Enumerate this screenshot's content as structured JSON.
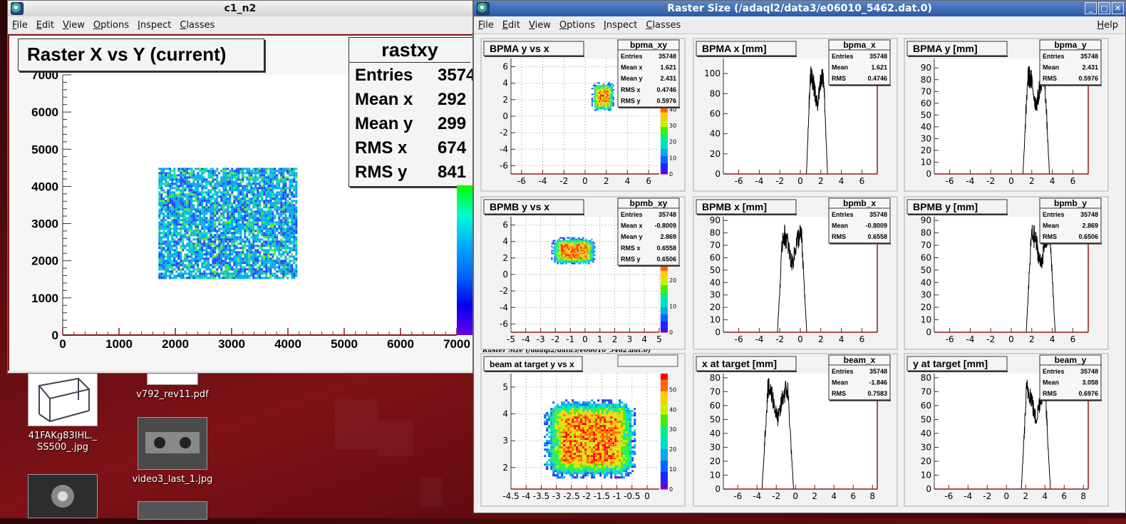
{
  "desktop": {
    "icons": [
      {
        "label": "41FAKg83IHL._\nSS500_.jpg"
      },
      {
        "label": "v792_rev11.pdf"
      },
      {
        "label": "video3_last_1.jpg"
      }
    ]
  },
  "left_window": {
    "title": "c1_n2",
    "menu": [
      "File",
      "Edit",
      "View",
      "Options",
      "Inspect",
      "Classes"
    ],
    "plot_title": "Raster X vs Y (current)",
    "stats": {
      "name": "rastxy",
      "rows": [
        {
          "label": "Entries",
          "value": "3574"
        },
        {
          "label": "Mean x",
          "value": "292"
        },
        {
          "label": "Mean y",
          "value": "299"
        },
        {
          "label": "RMS x",
          "value": "674"
        },
        {
          "label": "RMS y",
          "value": "841"
        }
      ]
    },
    "chart_data": {
      "type": "heatmap",
      "title": "Raster X vs Y (current)",
      "xlim": [
        0,
        7000
      ],
      "ylim": [
        0,
        7000
      ],
      "xticks": [
        "0",
        "1000",
        "2000",
        "3000",
        "4000",
        "5000",
        "6000",
        "7000"
      ],
      "yticks": [
        "0",
        "1000",
        "2000",
        "3000",
        "4000",
        "5000",
        "6000",
        "7000"
      ],
      "region": {
        "x": [
          1700,
          4150
        ],
        "y": [
          1550,
          4500
        ]
      }
    }
  },
  "right_window": {
    "title": "Raster Size (/adaql2/data3/e06010_5462.dat.0)",
    "menu": [
      "File",
      "Edit",
      "View",
      "Options",
      "Inspect",
      "Classes"
    ],
    "help": "Help",
    "caption": "Raster Size (/adaql2/data3/e06010_5462.dat.0)",
    "window_buttons": [
      "_",
      "□",
      "✕"
    ],
    "colors": {
      "curve": "#000000",
      "axis_frame": "#8b1a1a"
    }
  },
  "chart_data": [
    {
      "type": "heatmap",
      "title": "BPMA y vs x",
      "stat_name": "bpma_xy",
      "stats": [
        [
          "Entries",
          "35748"
        ],
        [
          "Mean x",
          "1.621"
        ],
        [
          "Mean y",
          "2.431"
        ],
        [
          "RMS x",
          "0.4746"
        ],
        [
          "RMS y",
          "0.5976"
        ]
      ],
      "xlim": [
        -7,
        7
      ],
      "ylim": [
        -7,
        7
      ],
      "xticks": [
        -6,
        -4,
        -2,
        0,
        2,
        4,
        6
      ],
      "yticks": [
        -6,
        -4,
        -2,
        0,
        2,
        4,
        6
      ],
      "blob": {
        "x": [
          1.0,
          2.3
        ],
        "y": [
          1.2,
          3.6
        ]
      },
      "zticks": [
        "0",
        "10",
        "20",
        "30",
        "40"
      ],
      "zmax": 45
    },
    {
      "type": "line",
      "title": "BPMA x [mm]",
      "stat_name": "bpma_x",
      "stats": [
        [
          "Entries",
          "35748"
        ],
        [
          "Mean",
          "1.621"
        ],
        [
          "RMS",
          "0.4746"
        ]
      ],
      "xlim": [
        -7.5,
        7.5
      ],
      "ylim": [
        0,
        115
      ],
      "xticks": [
        -6,
        -4,
        -2,
        0,
        2,
        4,
        6
      ],
      "yticks": [
        0,
        20,
        40,
        60,
        80,
        100
      ],
      "peak": {
        "center": 1.621,
        "halfwidth": 0.82,
        "height": 110
      }
    },
    {
      "type": "line",
      "title": "BPMA y [mm]",
      "stat_name": "bpma_y",
      "stats": [
        [
          "Entries",
          "35748"
        ],
        [
          "Mean",
          "2.431"
        ],
        [
          "RMS",
          "0.5976"
        ]
      ],
      "xlim": [
        -7.5,
        7.5
      ],
      "ylim": [
        0,
        98
      ],
      "xticks": [
        -6,
        -4,
        -2,
        0,
        2,
        4,
        6
      ],
      "yticks": [
        0,
        10,
        20,
        30,
        40,
        50,
        60,
        70,
        80,
        90
      ],
      "peak": {
        "center": 2.431,
        "halfwidth": 1.03,
        "height": 93
      }
    },
    {
      "type": "heatmap",
      "title": "BPMB y vs x",
      "stat_name": "bpmb_xy",
      "stats": [
        [
          "Entries",
          "35748"
        ],
        [
          "Mean x",
          "-0.8009"
        ],
        [
          "Mean y",
          "2.869"
        ],
        [
          "RMS x",
          "0.6558"
        ],
        [
          "RMS y",
          "0.6506"
        ]
      ],
      "xlim": [
        -5,
        5
      ],
      "ylim": [
        -7,
        7
      ],
      "xticks": [
        -5,
        -4,
        -3,
        -2,
        -1,
        0,
        1,
        2,
        3,
        4,
        5
      ],
      "yticks": [
        -6,
        -4,
        -2,
        0,
        2,
        4,
        6
      ],
      "blob": {
        "x": [
          -2.0,
          0.4
        ],
        "y": [
          1.8,
          4.0
        ]
      },
      "zticks": [
        "0",
        "10",
        "20"
      ],
      "zmax": 28
    },
    {
      "type": "line",
      "title": "BPMB x [mm]",
      "stat_name": "bpmb_x",
      "stats": [
        [
          "Entries",
          "35748"
        ],
        [
          "Mean",
          "-0.8009"
        ],
        [
          "RMS",
          "0.6558"
        ]
      ],
      "xlim": [
        -7.5,
        7.5
      ],
      "ylim": [
        0,
        93
      ],
      "xticks": [
        -6,
        -4,
        -2,
        0,
        2,
        4,
        6
      ],
      "yticks": [
        0,
        10,
        20,
        30,
        40,
        50,
        60,
        70,
        80,
        90
      ],
      "peak": {
        "center": -0.8009,
        "halfwidth": 1.14,
        "height": 88
      }
    },
    {
      "type": "line",
      "title": "BPMB y [mm]",
      "stat_name": "bpmb_y",
      "stats": [
        [
          "Entries",
          "35748"
        ],
        [
          "Mean",
          "2.869"
        ],
        [
          "RMS",
          "0.6506"
        ]
      ],
      "xlim": [
        -7.5,
        7.5
      ],
      "ylim": [
        0,
        93
      ],
      "xticks": [
        -6,
        -4,
        -2,
        0,
        2,
        4,
        6
      ],
      "yticks": [
        0,
        10,
        20,
        30,
        40,
        50,
        60,
        70,
        80,
        90
      ],
      "peak": {
        "center": 2.869,
        "halfwidth": 1.13,
        "height": 88
      }
    },
    {
      "type": "heatmap",
      "title": "beam at target y vs x",
      "stat_name": "",
      "stats": [],
      "xlim": [
        -4.5,
        0.4
      ],
      "ylim": [
        1.2,
        5.5
      ],
      "xticks": [
        -4.5,
        -4,
        -3.5,
        -3,
        -2.5,
        -2,
        -1.5,
        -1,
        -0.5,
        0
      ],
      "xticklabels": [
        "-4.5",
        "-4",
        "-3.5",
        "-3",
        "-2.5",
        "-2",
        "-1.5",
        "-1",
        "-0.5",
        "0"
      ],
      "yticks": [
        2,
        3,
        4,
        5
      ],
      "blob": {
        "x": [
          -3.2,
          -0.6
        ],
        "y": [
          1.9,
          4.3
        ]
      },
      "zticks": [
        "0",
        "10",
        "20",
        "30",
        "40",
        "50"
      ],
      "zmax": 58
    },
    {
      "type": "line",
      "title": "x at target [mm]",
      "stat_name": "beam_x",
      "stats": [
        [
          "Entries",
          "35748"
        ],
        [
          "Mean",
          "-1.846"
        ],
        [
          "RMS",
          "0.7583"
        ]
      ],
      "xlim": [
        -7.5,
        8.5
      ],
      "ylim": [
        0,
        83
      ],
      "xticks": [
        -6,
        -4,
        -2,
        0,
        2,
        4,
        6,
        8
      ],
      "yticks": [
        0,
        10,
        20,
        30,
        40,
        50,
        60,
        70,
        80
      ],
      "peak": {
        "center": -1.846,
        "halfwidth": 1.31,
        "height": 80
      }
    },
    {
      "type": "line",
      "title": "y at target [mm]",
      "stat_name": "beam_y",
      "stats": [
        [
          "Entries",
          "35748"
        ],
        [
          "Mean",
          "3.058"
        ],
        [
          "RMS",
          "0.6976"
        ]
      ],
      "xlim": [
        -7.5,
        8.5
      ],
      "ylim": [
        0,
        83
      ],
      "xticks": [
        -6,
        -4,
        -2,
        0,
        2,
        4,
        6,
        8
      ],
      "yticks": [
        0,
        10,
        20,
        30,
        40,
        50,
        60,
        70,
        80
      ],
      "peak": {
        "center": 3.058,
        "halfwidth": 1.21,
        "height": 80
      }
    }
  ]
}
